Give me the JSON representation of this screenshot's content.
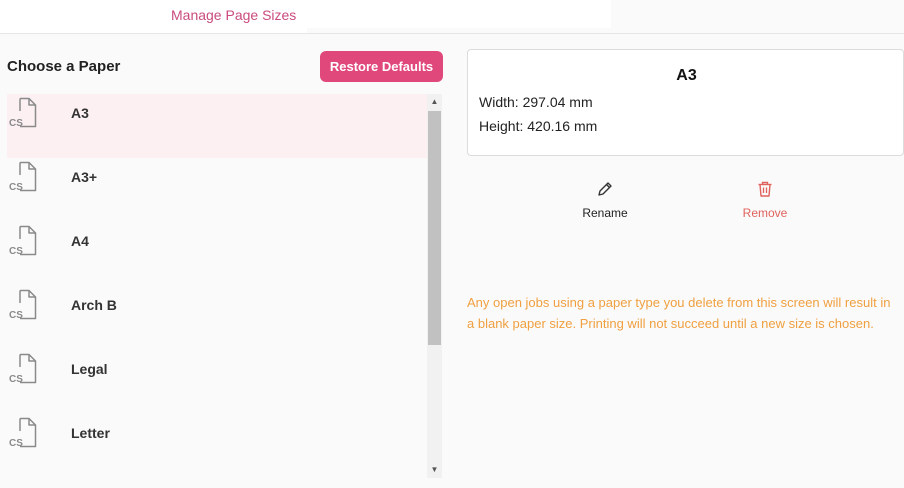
{
  "header": {
    "tab_label": "Manage Page Sizes"
  },
  "left_panel": {
    "title": "Choose a Paper",
    "restore_label": "Restore Defaults",
    "icon_text": "CS",
    "items": [
      {
        "label": "A3",
        "selected": true
      },
      {
        "label": "A3+",
        "selected": false
      },
      {
        "label": "A4",
        "selected": false
      },
      {
        "label": "Arch B",
        "selected": false
      },
      {
        "label": "Legal",
        "selected": false
      },
      {
        "label": "Letter",
        "selected": false
      }
    ]
  },
  "detail": {
    "title": "A3",
    "width": "Width: 297.04 mm",
    "height": "Height: 420.16 mm"
  },
  "actions": {
    "rename_label": "Rename",
    "remove_label": "Remove"
  },
  "warning": "Any open jobs using a paper type you delete from this screen will result in a blank paper size. Printing will not succeed until a new size is chosen.",
  "colors": {
    "accent": "#e0487c",
    "tab_text": "#c94b7e",
    "selected_bg": "#fdf0f3",
    "warning": "#f0a040",
    "remove": "#e0625d"
  }
}
